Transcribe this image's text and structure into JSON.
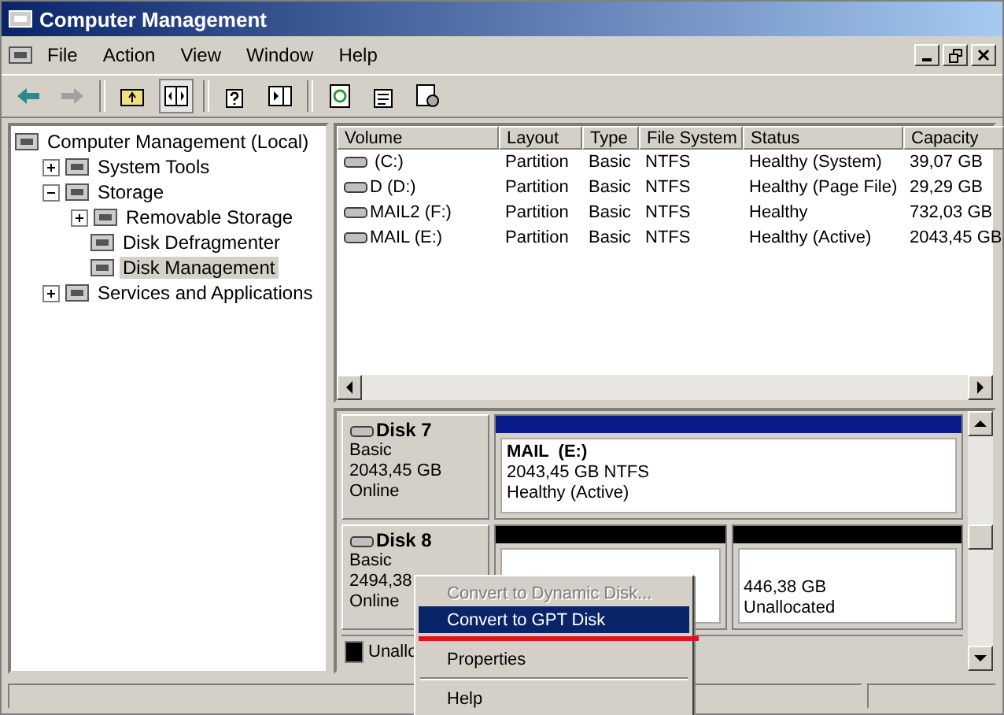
{
  "window": {
    "title": "Computer Management"
  },
  "menu": [
    "File",
    "Action",
    "View",
    "Window",
    "Help"
  ],
  "tree": [
    {
      "label": "Computer Management (Local)",
      "selected": false,
      "children": [
        {
          "label": "System Tools",
          "expanded": false,
          "selected": false
        },
        {
          "label": "Storage",
          "expanded": true,
          "selected": false,
          "children": [
            {
              "label": "Removable Storage",
              "expanded": false,
              "selected": false
            },
            {
              "label": "Disk Defragmenter",
              "selected": false
            },
            {
              "label": "Disk Management",
              "selected": true
            }
          ]
        },
        {
          "label": "Services and Applications",
          "expanded": false,
          "selected": false
        }
      ]
    }
  ],
  "volumes": {
    "columns": [
      "Volume",
      "Layout",
      "Type",
      "File System",
      "Status",
      "Capacity"
    ],
    "rows": [
      [
        " (C:)",
        "Partition",
        "Basic",
        "NTFS",
        "Healthy (System)",
        "39,07 GB"
      ],
      [
        "D (D:)",
        "Partition",
        "Basic",
        "NTFS",
        "Healthy (Page File)",
        "29,29 GB"
      ],
      [
        "MAIL2 (F:)",
        "Partition",
        "Basic",
        "NTFS",
        "Healthy",
        "732,03 GB"
      ],
      [
        "MAIL (E:)",
        "Partition",
        "Basic",
        "NTFS",
        "Healthy (Active)",
        "2043,45 GB"
      ]
    ]
  },
  "disks": [
    {
      "name": "Disk 7",
      "type": "Basic",
      "size": "2043,45 GB",
      "status": "Online",
      "partitions": [
        {
          "kind": "primary",
          "label": "MAIL  (E:)",
          "size": "2043,45 GB NTFS",
          "status": "Healthy (Active)"
        }
      ]
    },
    {
      "name": "Disk 8",
      "type": "Basic",
      "size": "2494,38",
      "status": "Online",
      "partitions": [
        {
          "kind": "unallocated"
        },
        {
          "kind": "unallocated",
          "size": "446,38 GB",
          "status": "Unallocated"
        }
      ]
    }
  ],
  "legend": [
    {
      "kind": "unallocated",
      "label": "Unallo"
    }
  ],
  "context_menu": [
    {
      "kind": "item",
      "label": "Convert to Dynamic Disk...",
      "disabled": true,
      "selected": false,
      "marked": false
    },
    {
      "kind": "item",
      "label": "Convert to GPT Disk",
      "disabled": false,
      "selected": true,
      "marked": true
    },
    {
      "kind": "separator"
    },
    {
      "kind": "item",
      "label": "Properties",
      "disabled": false,
      "selected": false,
      "marked": false
    },
    {
      "kind": "separator"
    },
    {
      "kind": "item",
      "label": "Help",
      "disabled": false,
      "selected": false,
      "marked": false
    }
  ]
}
